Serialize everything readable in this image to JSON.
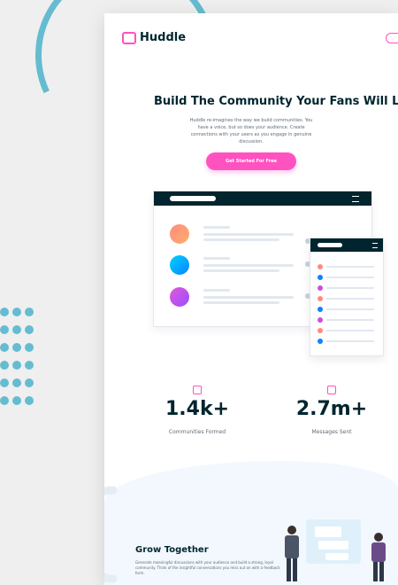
{
  "brand": {
    "name": "Huddle",
    "accent": "#ff52c1",
    "dark": "#00252e",
    "deco": "#65bcd1"
  },
  "hero": {
    "title": "Build The Community Your Fans Will Love",
    "description": "Huddle re-imagines the way we build communities. You have a voice, but so does your audience. Create connections with your users as you engage in genuine discussion.",
    "cta_label": "Get Started For Free"
  },
  "stats": [
    {
      "icon": "communities-icon",
      "value": "1.4k+",
      "label": "Communities Formed"
    },
    {
      "icon": "messages-icon",
      "value": "2.7m+",
      "label": "Messages Sent"
    }
  ],
  "feature": {
    "title": "Grow Together",
    "description": "Generate meaningful discussions with your audience and build a strong, loyal community. Think of the insightful conversations you miss out on with a feedback form."
  }
}
